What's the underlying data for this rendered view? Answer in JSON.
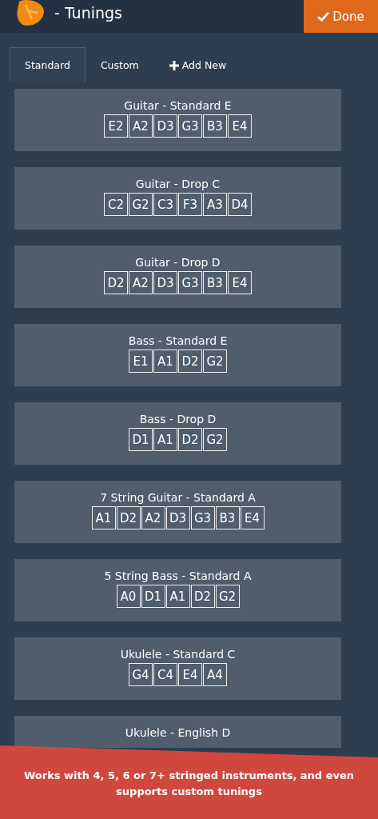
{
  "header": {
    "title": "- Tunings",
    "done_button": "Done"
  },
  "tabs": [
    {
      "label": "Standard",
      "selected": true,
      "kind": "tab"
    },
    {
      "label": "Custom",
      "selected": false,
      "kind": "tab"
    },
    {
      "label": "Add New",
      "selected": false,
      "kind": "add"
    }
  ],
  "tunings": [
    {
      "name": "Guitar - Standard E",
      "notes": [
        "E2",
        "A2",
        "D3",
        "G3",
        "B3",
        "E4"
      ]
    },
    {
      "name": "Guitar - Drop C",
      "notes": [
        "C2",
        "G2",
        "C3",
        "F3",
        "A3",
        "D4"
      ]
    },
    {
      "name": "Guitar - Drop D",
      "notes": [
        "D2",
        "A2",
        "D3",
        "G3",
        "B3",
        "E4"
      ]
    },
    {
      "name": "Bass - Standard E",
      "notes": [
        "E1",
        "A1",
        "D2",
        "G2"
      ]
    },
    {
      "name": "Bass - Drop D",
      "notes": [
        "D1",
        "A1",
        "D2",
        "G2"
      ]
    },
    {
      "name": "7 String Guitar - Standard A",
      "notes": [
        "A1",
        "D2",
        "A2",
        "D3",
        "G3",
        "B3",
        "E4"
      ]
    },
    {
      "name": "5 String Bass - Standard A",
      "notes": [
        "A0",
        "D1",
        "A1",
        "D2",
        "G2"
      ]
    },
    {
      "name": "Ukulele - Standard C",
      "notes": [
        "G4",
        "C4",
        "E4",
        "A4"
      ]
    },
    {
      "name": "Ukulele - English D"
    }
  ],
  "banner": {
    "text": "Works with 4, 5, 6 or 7+ stringed instruments, and even supports custom tunings"
  }
}
